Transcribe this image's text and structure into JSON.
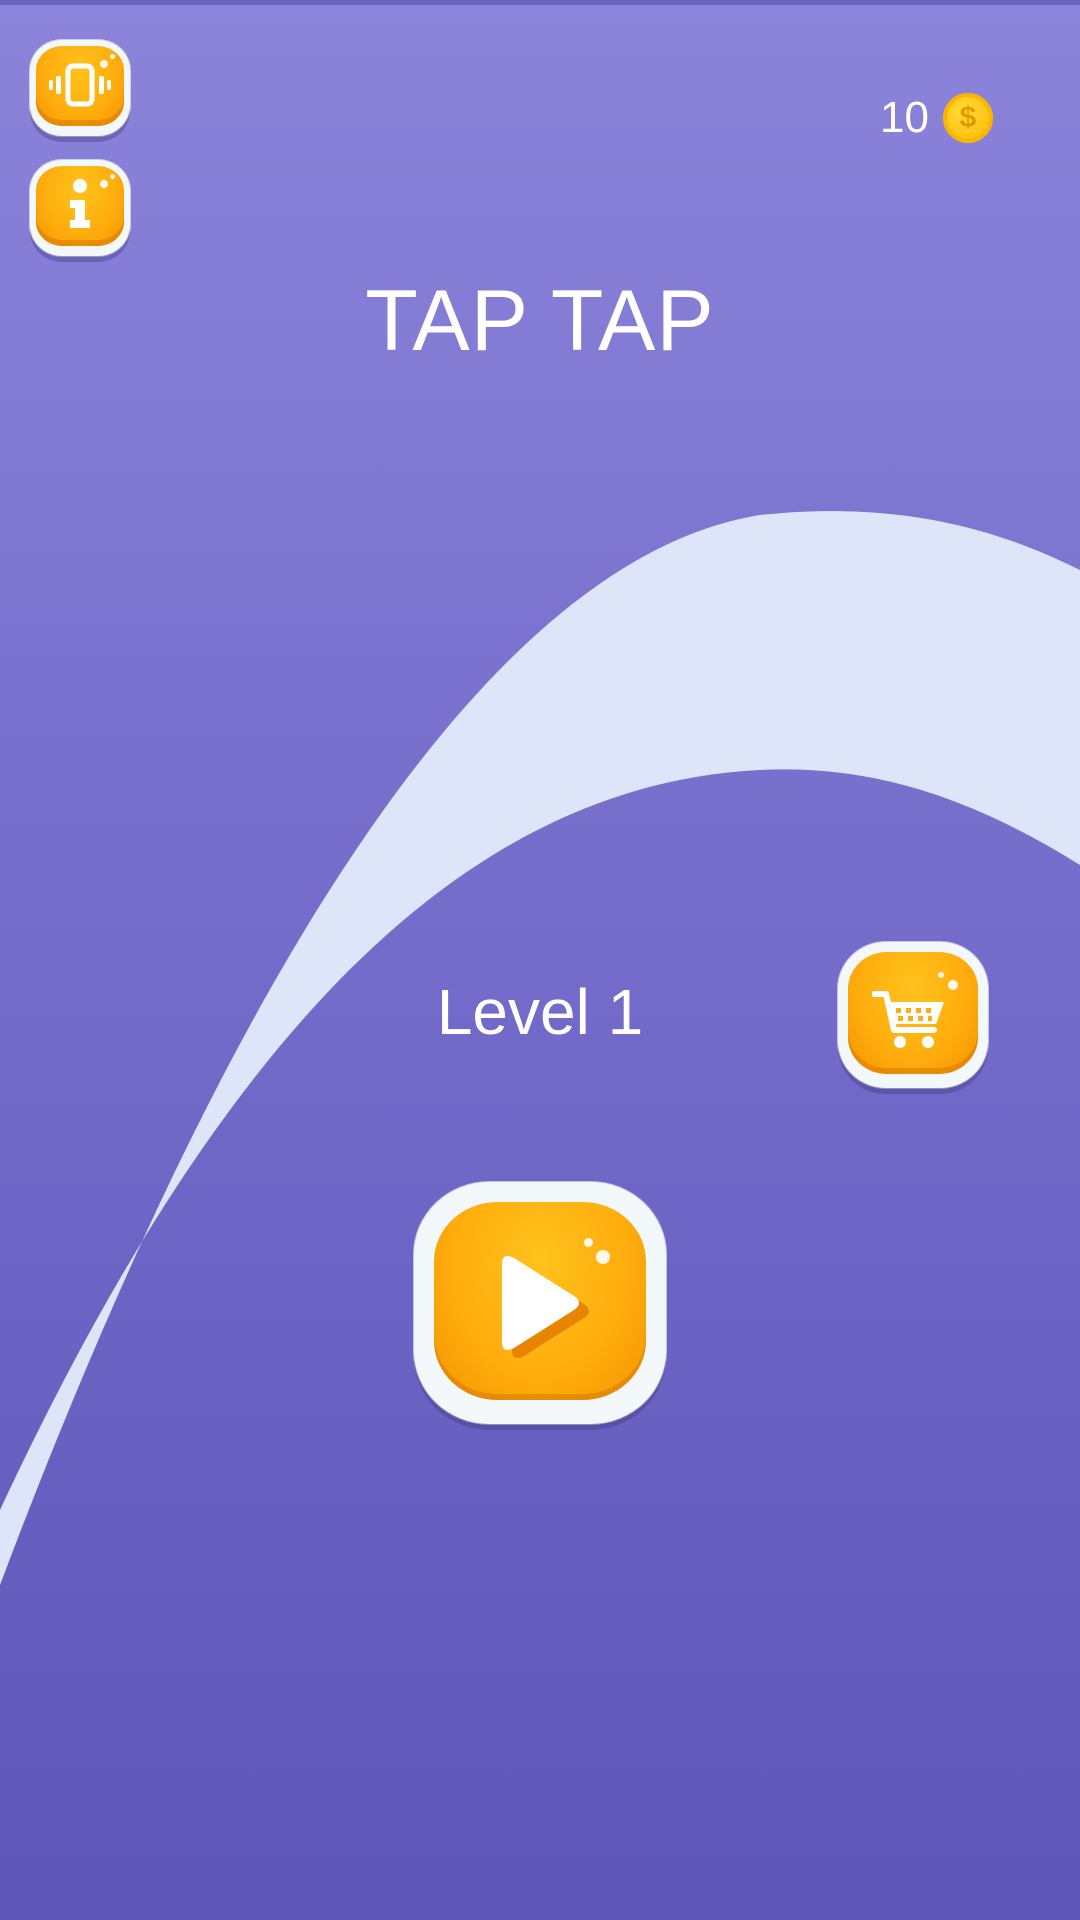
{
  "game": {
    "title": "TAP TAP",
    "level_label": "Level 1"
  },
  "hud": {
    "coin_count": "10",
    "coin_symbol": "$"
  },
  "buttons": {
    "vibrate_icon": "vibrate-icon",
    "info_icon": "info-icon",
    "shop_icon": "shopping-cart-icon",
    "play_icon": "play-icon"
  },
  "colors": {
    "background_top": "#8c84da",
    "background_bottom": "#5e56b6",
    "swoosh": "#dde6f8",
    "button_orange": "#ffae0e",
    "button_rim": "#f3f8fb",
    "coin_gold": "#ffc414"
  }
}
